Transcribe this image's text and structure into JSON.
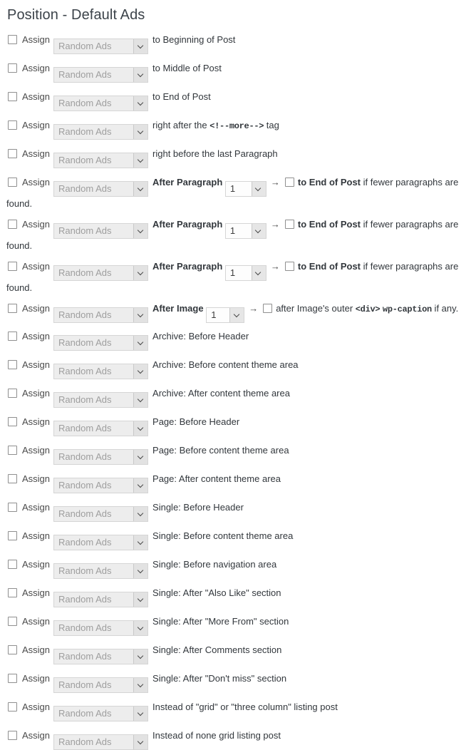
{
  "page": {
    "title": "Position - Default Ads"
  },
  "labels": {
    "assign": "Assign",
    "select_value": "Random Ads",
    "number_value": "1",
    "arrow": "→",
    "after_paragraph": "After Paragraph",
    "after_image": "After Image"
  },
  "simple_rows_top": [
    {
      "prefix": "to ",
      "strong": "Beginning of Post",
      "suffix": ""
    },
    {
      "prefix": "to ",
      "strong": "Middle of Post",
      "suffix": ""
    },
    {
      "prefix": "to ",
      "strong": "End of Post",
      "suffix": ""
    }
  ],
  "mono_rows": [
    {
      "prefix": "right after the ",
      "mono": "<!--more-->",
      "suffix": " tag"
    }
  ],
  "bold_rows": [
    {
      "prefix": "right before ",
      "strong": "the last Paragraph",
      "suffix": ""
    }
  ],
  "paragraph_rows": [
    {
      "label": "After Paragraph",
      "number": "1",
      "tail_strong": "to End of Post",
      "tail_plain": " if fewer paragraphs are found."
    },
    {
      "label": "After Paragraph",
      "number": "1",
      "tail_strong": "to End of Post",
      "tail_plain": " if fewer paragraphs are found."
    },
    {
      "label": "After Paragraph",
      "number": "1",
      "tail_strong": "to End of Post",
      "tail_plain": " if fewer paragraphs are found."
    }
  ],
  "image_row": {
    "label": "After Image",
    "number": "1",
    "tail_prefix": "after Image's outer ",
    "tail_mono1": "<div>",
    "tail_mid": " ",
    "tail_mono2": "wp-caption",
    "tail_suffix": " if any."
  },
  "theme_rows": [
    {
      "label": "Archive: Before Header"
    },
    {
      "label": "Archive: Before content theme area"
    },
    {
      "label": "Archive: After content theme area"
    },
    {
      "label": "Page: Before Header"
    },
    {
      "label": "Page: Before content theme area"
    },
    {
      "label": "Page: After content theme area"
    },
    {
      "label": "Single: Before Header"
    },
    {
      "label": "Single: Before content theme area"
    },
    {
      "label": "Single: Before navigation area"
    },
    {
      "label": "Single: After \"Also Like\" section"
    },
    {
      "label": "Single: After \"More From\" section"
    },
    {
      "label": "Single: After Comments section"
    },
    {
      "label": "Single: After \"Don't miss\" section"
    },
    {
      "label": "Instead of \"grid\" or \"three column\" listing post"
    },
    {
      "label": "Instead of none grid listing post"
    }
  ],
  "colors": {
    "title": "#3c434a",
    "text": "#32373c",
    "select_bg": "#ededed",
    "select_placeholder": "#9e9e9e",
    "background": "#ffffff"
  }
}
